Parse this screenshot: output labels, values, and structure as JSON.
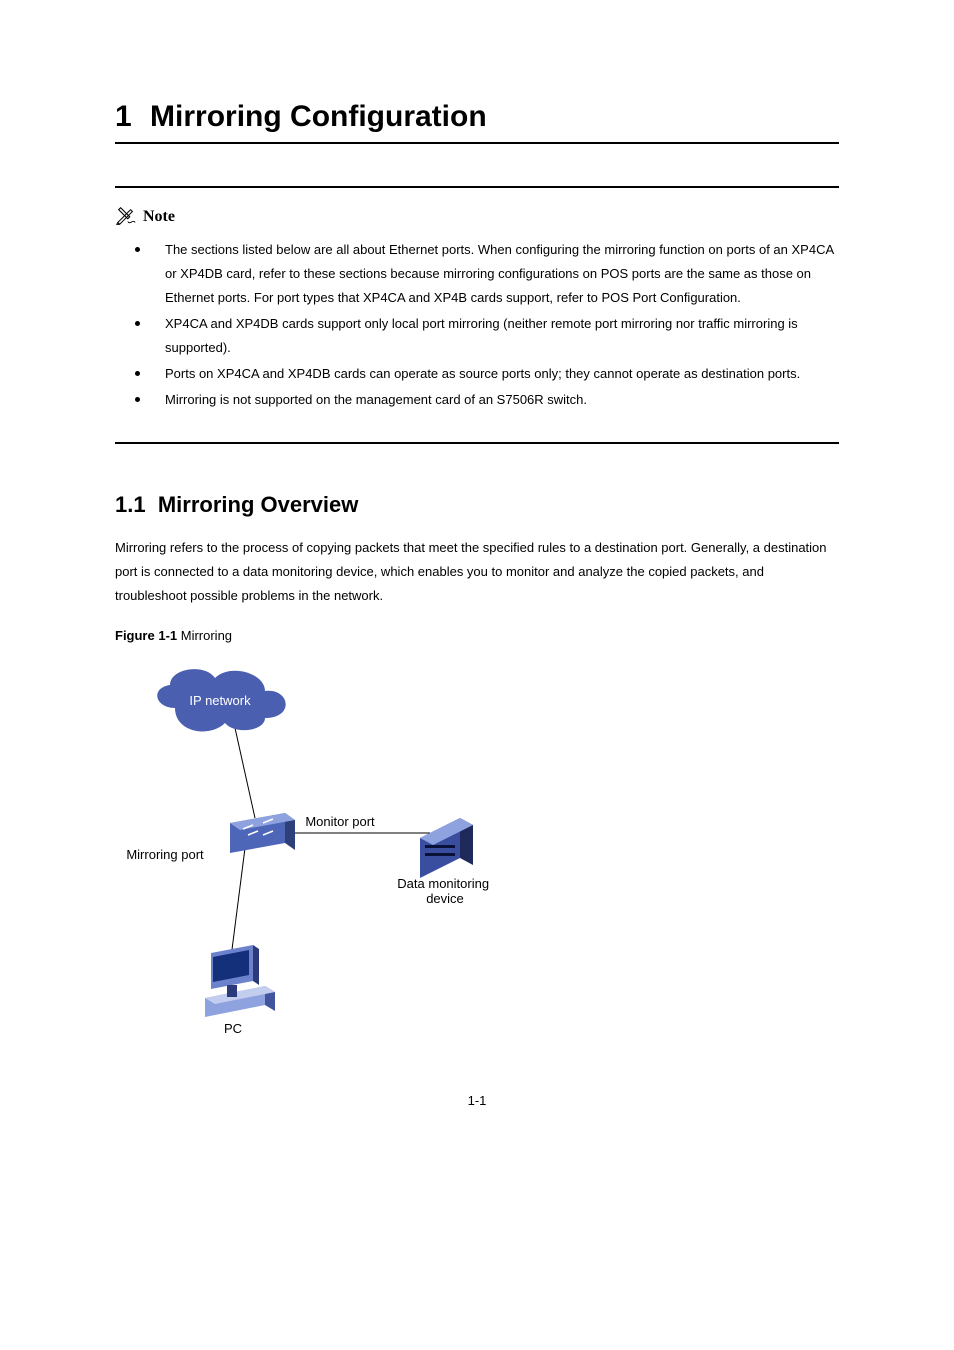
{
  "chapter": {
    "number": "1",
    "title": "Mirroring Configuration"
  },
  "note": {
    "label": "Note",
    "items": [
      "The sections listed below are all about Ethernet ports. When configuring the mirroring function on ports of an XP4CA or XP4DB card, refer to these sections because mirroring configurations on POS ports are the same as those on Ethernet ports. For port types that XP4CA and XP4B cards support, refer to POS Port Configuration.",
      "XP4CA and XP4DB cards support only local port mirroring (neither remote port mirroring nor traffic mirroring is supported).",
      "Ports on XP4CA and XP4DB cards can operate as source ports only; they cannot operate as destination ports.",
      "Mirroring is not supported on the management card of an S7506R switch."
    ]
  },
  "section": {
    "number": "1.1",
    "title": "Mirroring Overview",
    "paragraphs": [
      "Mirroring refers to the process of copying packets that meet the specified rules to a destination port. Generally, a destination port is connected to a data monitoring device, which enables you to monitor and analyze the copied packets, and troubleshoot possible problems in the network."
    ]
  },
  "figure": {
    "number": "Figure 1-1",
    "caption": "Mirroring",
    "labels": {
      "cloud": "IP network",
      "monitor_port": "Monitor port",
      "mirroring_port": "Mirroring port",
      "device": "Data monitoring device",
      "pc": "PC"
    }
  },
  "page_number": "1-1"
}
